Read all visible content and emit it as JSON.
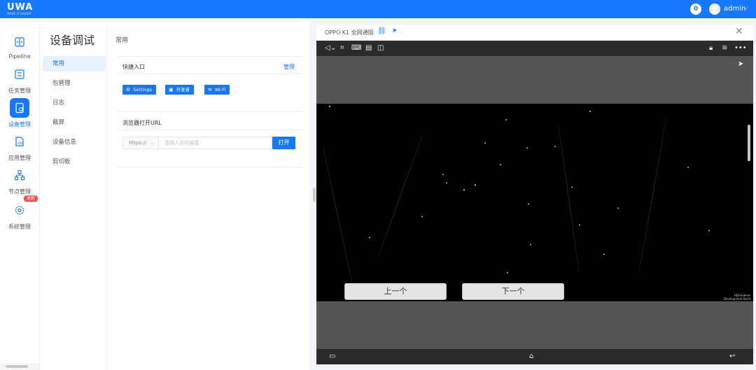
{
  "header": {
    "logo": "UWA",
    "logo_sub": "MAKE IT EASIER",
    "notification_count": "0",
    "user": "admin",
    "brand_color": "#1677ff"
  },
  "rail": {
    "items": [
      {
        "label": "Pipeline",
        "icon": "pipeline-icon"
      },
      {
        "label": "任务管理",
        "icon": "task-icon"
      },
      {
        "label": "设备管理",
        "icon": "device-icon",
        "active": true
      },
      {
        "label": "应用管理",
        "icon": "app-icon"
      },
      {
        "label": "节点管理",
        "icon": "node-icon",
        "tag": "更新"
      },
      {
        "label": "系统管理",
        "icon": "settings-icon"
      }
    ]
  },
  "subnav": {
    "title": "设备调试",
    "items": [
      "常用",
      "包管理",
      "日志",
      "截屏",
      "设备信息",
      "剪切板"
    ],
    "active_index": 0
  },
  "main": {
    "title": "常用",
    "quick": {
      "heading": "快捷入口",
      "manage": "管理",
      "buttons": [
        {
          "label": "Settings",
          "icon": "gear-icon"
        },
        {
          "label": "开发者",
          "icon": "developer-icon"
        },
        {
          "label": "Wi-Fi",
          "icon": "wifi-icon"
        }
      ]
    },
    "browser": {
      "heading": "浏览器打开URL",
      "protocol": "https://",
      "placeholder": "请输入访问链接",
      "open": "打开"
    }
  },
  "device": {
    "title": "OPPO K1 全网通版",
    "prev": "上一个",
    "next": "下一个",
    "watermark_1": "HDrenderer",
    "watermark_2": "Development Build"
  }
}
